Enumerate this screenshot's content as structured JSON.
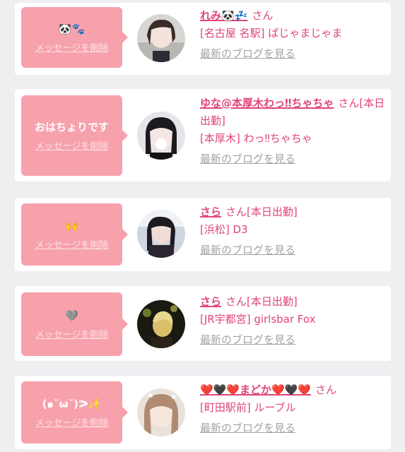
{
  "cards": [
    {
      "message": "🐼🐾",
      "delete_label": "メッセージを削除",
      "name": "れみ🐼💤",
      "san": "さん",
      "detail": "[名古屋 名駅] ぱじゃまじゃま",
      "blog_link": "最新のブログを見る"
    },
    {
      "message": "おはちょりです",
      "delete_label": "メッセージを削除",
      "name": "ゆな@本厚木わっ‼ちゃちゃ",
      "san": "さん",
      "status": "[本日出勤]",
      "detail": "[本厚木] わっ‼ちゃちゃ",
      "blog_link": "最新のブログを見る"
    },
    {
      "message": "🙌",
      "delete_label": "メッセージを削除",
      "name": "さら",
      "san": "さん",
      "status": "[本日出勤]",
      "detail": "[浜松] D3",
      "blog_link": "最新のブログを見る"
    },
    {
      "message": "🩶",
      "delete_label": "メッセージを削除",
      "name": "さら",
      "san": "さん",
      "status": "[本日出勤]",
      "detail": "[JR宇都宮] girlsbar Fox",
      "blog_link": "最新のブログを見る"
    },
    {
      "message": "(๑˘ω˘)ᕗ✨",
      "delete_label": "メッセージを削除",
      "name": "❤️🖤❤️まどか❤️🖤❤️",
      "san": "さん",
      "detail": "[町田駅前] ルーブル",
      "blog_link": "最新のブログを見る"
    }
  ],
  "colors": {
    "accent": "#e0447a",
    "bubble": "#f7a1ad",
    "background": "#efeff2",
    "link_gray": "#a3a3a3"
  }
}
